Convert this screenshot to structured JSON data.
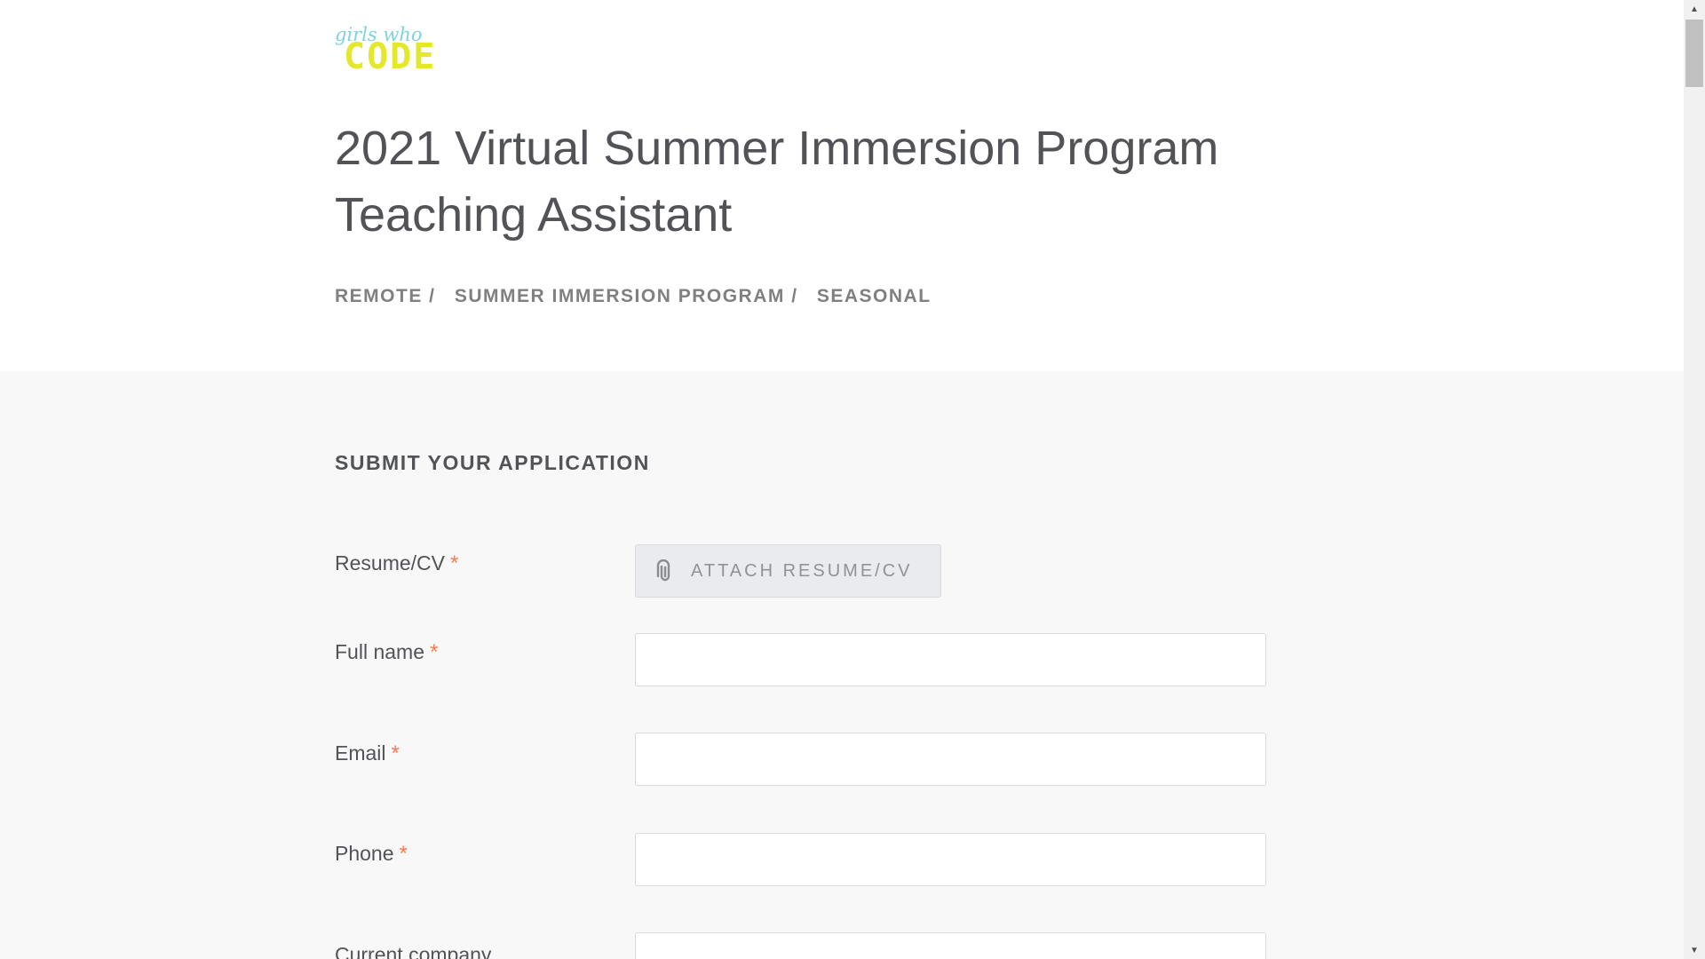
{
  "logo": {
    "script_text": "girls who",
    "word_text": "CODE"
  },
  "job": {
    "title": "2021 Virtual Summer Immersion Program Teaching Assistant",
    "tags": [
      "REMOTE /",
      "SUMMER IMMERSION PROGRAM /",
      "SEASONAL"
    ]
  },
  "form": {
    "section_title": "SUBMIT YOUR APPLICATION",
    "required_mark": "*",
    "resume": {
      "label": "Resume/CV",
      "button_label": "ATTACH RESUME/CV"
    },
    "fields": [
      {
        "label": "Full name",
        "value": "",
        "placeholder": ""
      },
      {
        "label": "Email",
        "value": "",
        "placeholder": ""
      },
      {
        "label": "Phone",
        "value": "",
        "placeholder": ""
      },
      {
        "label": "Current company",
        "value": "",
        "placeholder": ""
      }
    ]
  },
  "scrollbar": {
    "up_icon": "triangle-up-icon",
    "down_icon": "triangle-down-icon"
  }
}
